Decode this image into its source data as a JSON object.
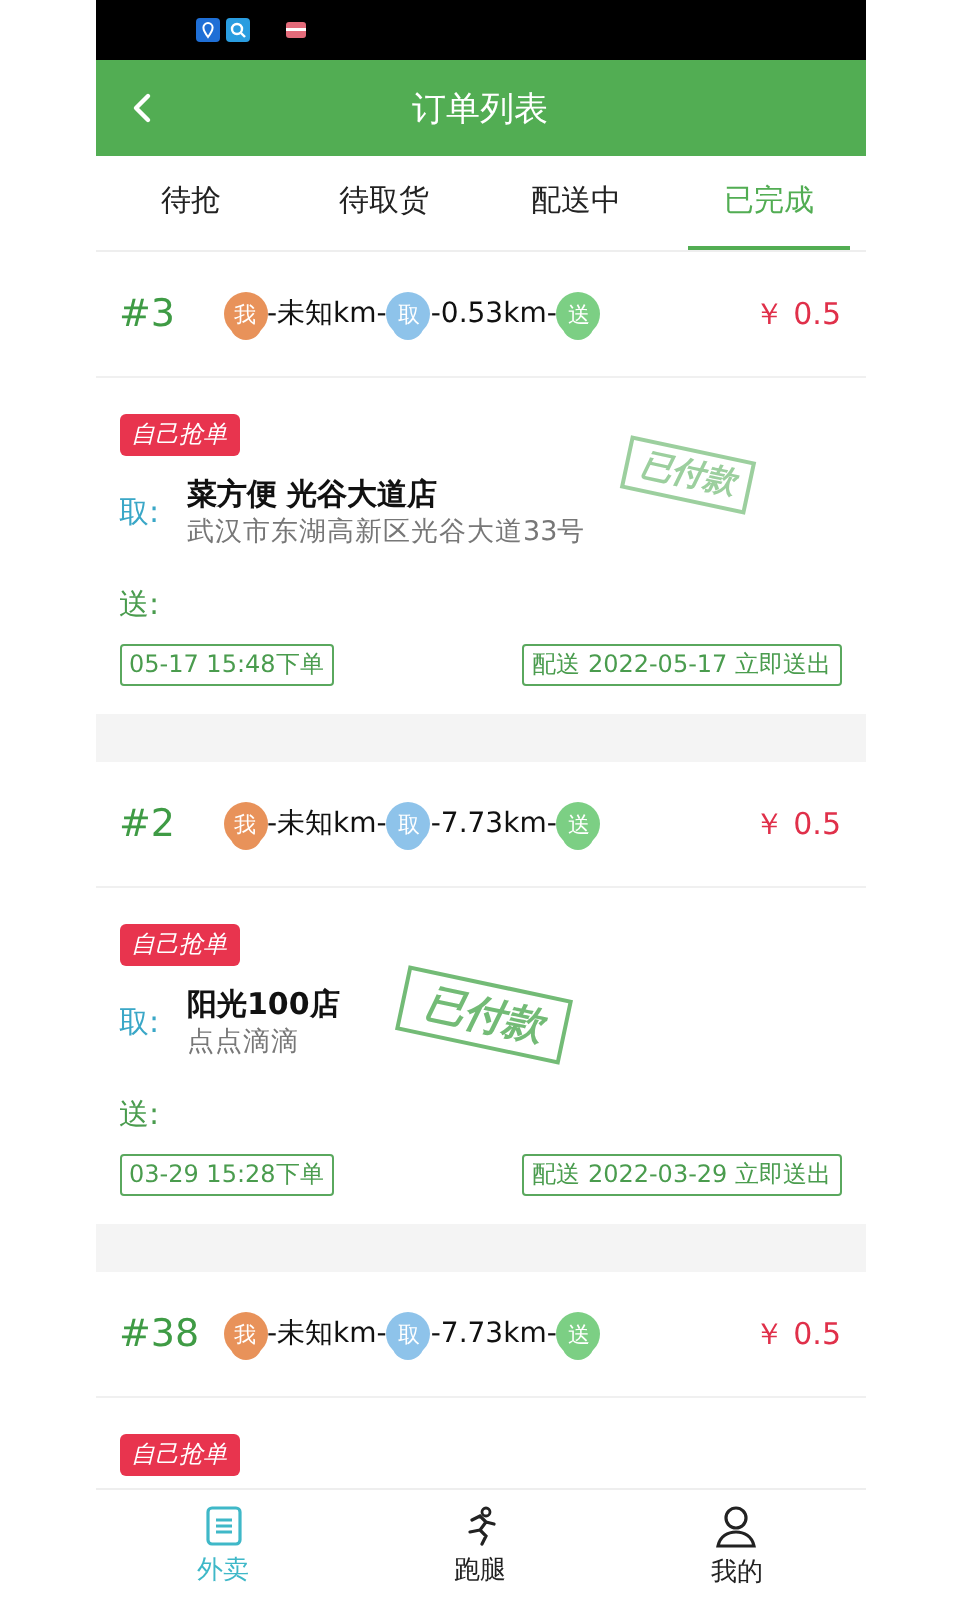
{
  "header": {
    "title": "订单列表"
  },
  "tabs": [
    {
      "label": "待抢",
      "selected": false
    },
    {
      "label": "待取货",
      "selected": false
    },
    {
      "label": "配送中",
      "selected": false
    },
    {
      "label": "已完成",
      "selected": true
    }
  ],
  "orders": [
    {
      "number": "#3",
      "route": [
        {
          "kind": "pin",
          "label": "我",
          "color": "#e8925a"
        },
        {
          "kind": "text",
          "text": "-未知km-"
        },
        {
          "kind": "pin",
          "label": "取",
          "color": "#8ec3ea"
        },
        {
          "kind": "text",
          "text": "-0.53km-"
        },
        {
          "kind": "pin",
          "label": "送",
          "color": "#7ccf84"
        }
      ],
      "price": "￥ 0.5",
      "tag": "自己抢单",
      "pickup_label": "取:",
      "pickup_name": "菜方便 光谷大道店",
      "pickup_address": "武汉市东湖高新区光谷大道33号",
      "delivery_label": "送:",
      "stamp": "已付款",
      "order_time": "05-17 15:48下单",
      "delivery_time": "配送 2022-05-17 立即送出"
    },
    {
      "number": "#2",
      "route": [
        {
          "kind": "pin",
          "label": "我",
          "color": "#e8925a"
        },
        {
          "kind": "text",
          "text": "-未知km-"
        },
        {
          "kind": "pin",
          "label": "取",
          "color": "#8ec3ea"
        },
        {
          "kind": "text",
          "text": "-7.73km-"
        },
        {
          "kind": "pin",
          "label": "送",
          "color": "#7ccf84"
        }
      ],
      "price": "￥ 0.5",
      "tag": "自己抢单",
      "pickup_label": "取:",
      "pickup_name": "阳光100店",
      "pickup_address": "点点滴滴",
      "delivery_label": "送:",
      "stamp": "已付款",
      "order_time": "03-29 15:28下单",
      "delivery_time": "配送 2022-03-29 立即送出"
    },
    {
      "number": "#38",
      "route": [
        {
          "kind": "pin",
          "label": "我",
          "color": "#e8925a"
        },
        {
          "kind": "text",
          "text": "-未知km-"
        },
        {
          "kind": "pin",
          "label": "取",
          "color": "#8ec3ea"
        },
        {
          "kind": "text",
          "text": "-7.73km-"
        },
        {
          "kind": "pin",
          "label": "送",
          "color": "#7ccf84"
        }
      ],
      "price": "￥ 0.5",
      "tag": "自己抢单"
    }
  ],
  "nav": [
    {
      "label": "外卖",
      "kind": "list",
      "selected": true
    },
    {
      "label": "跑腿",
      "kind": "runner",
      "selected": false
    },
    {
      "label": "我的",
      "kind": "person",
      "selected": false
    }
  ]
}
